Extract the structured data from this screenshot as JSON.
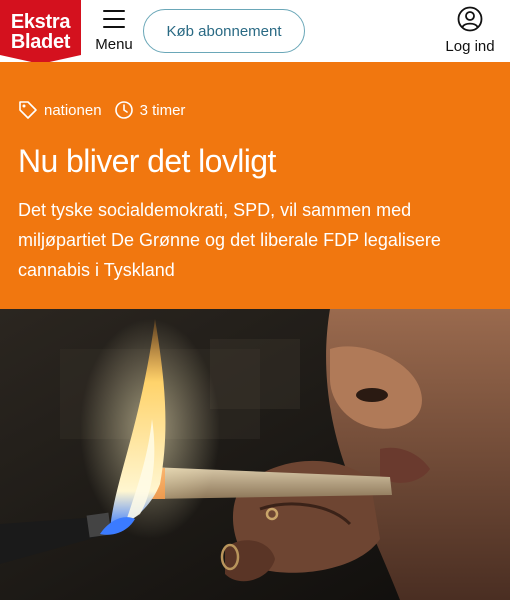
{
  "header": {
    "logo_line1": "Ekstra",
    "logo_line2": "Bladet",
    "menu_label": "Menu",
    "subscribe_label": "Køb abonnement",
    "login_label": "Log ind"
  },
  "article": {
    "section": "nationen",
    "time": "3 timer",
    "headline": "Nu bliver det lovligt",
    "lead": "Det tyske socialdemokrati, SPD, vil sammen med miljøpartiet De Grønne og det liberale FDP legalisere cannabis i Tyskland"
  },
  "colors": {
    "brand_red": "#d4111e",
    "teaser_orange": "#f1770f",
    "subscribe_border": "#6aa7b8"
  },
  "icons": [
    "menu-icon",
    "user-icon",
    "tag-icon",
    "clock-icon"
  ]
}
